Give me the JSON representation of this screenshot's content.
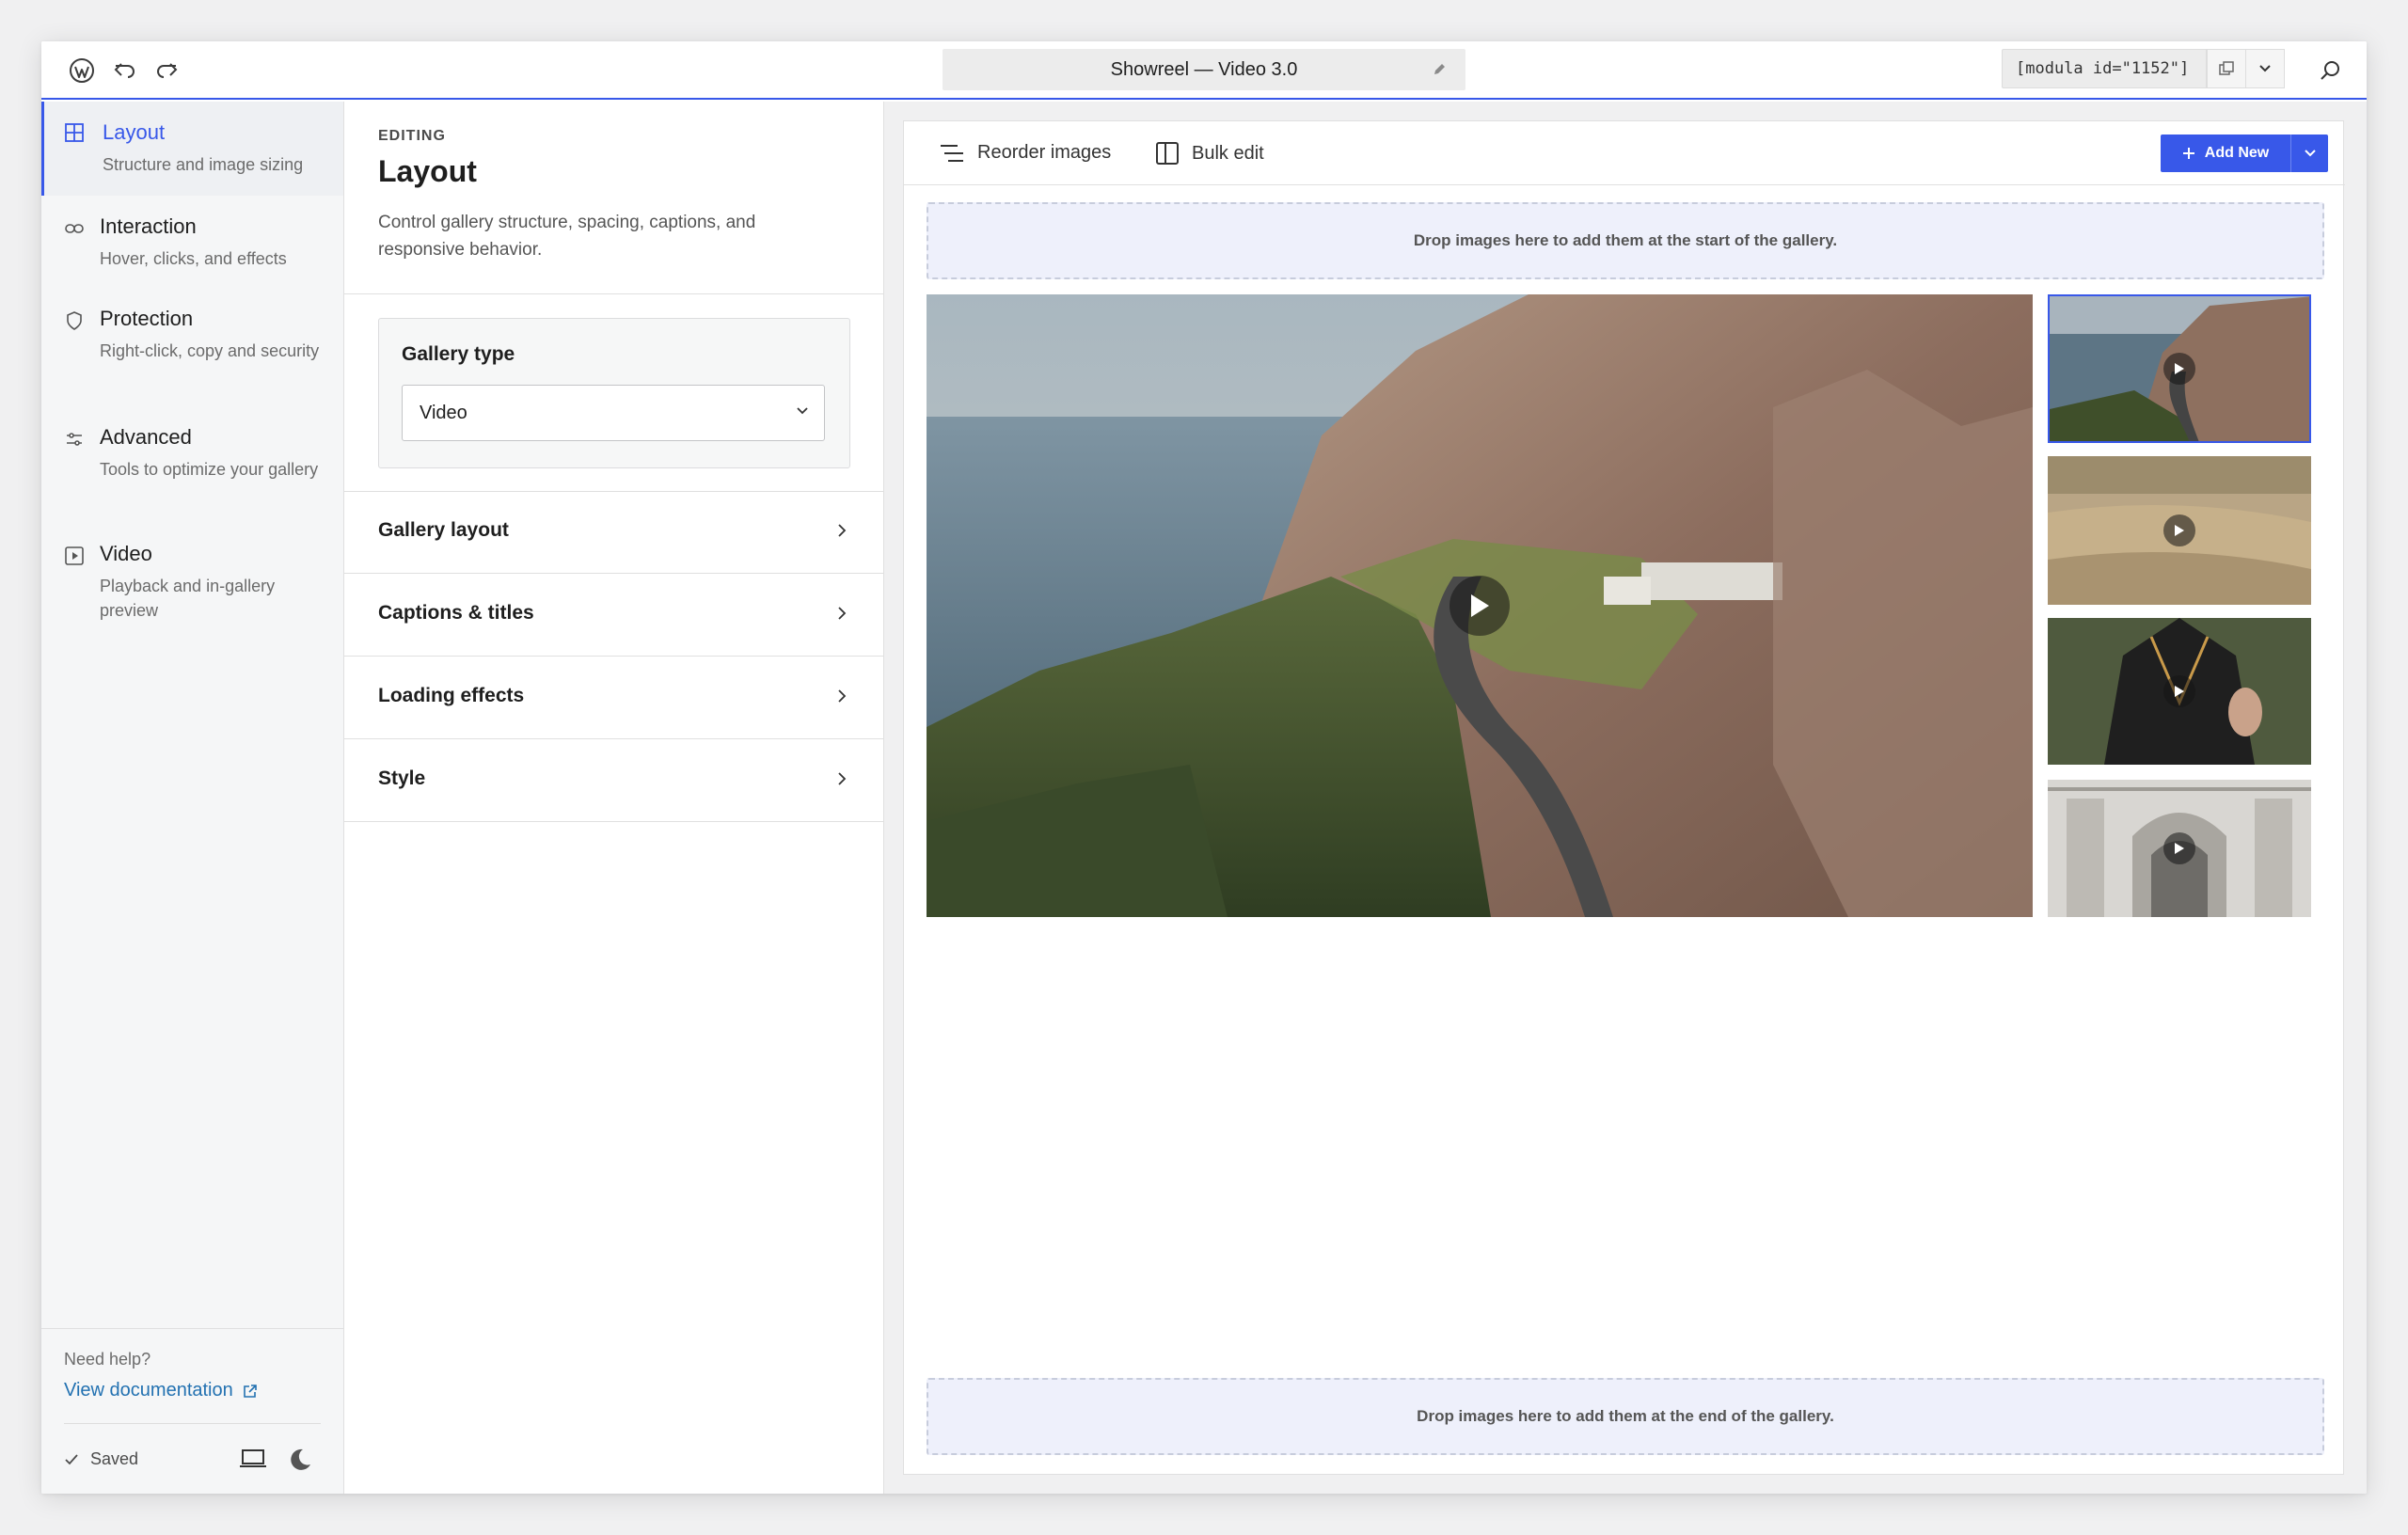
{
  "header": {
    "title": "Showreel — Video 3.0",
    "shortcode": "[modula id=\"1152\"]"
  },
  "sidebar": {
    "items": [
      {
        "label": "Layout",
        "desc": "Structure and image sizing",
        "icon": "grid-icon"
      },
      {
        "label": "Interaction",
        "desc": "Hover, clicks, and effects",
        "icon": "link-icon"
      },
      {
        "label": "Protection",
        "desc": "Right-click, copy and security",
        "icon": "shield-icon"
      },
      {
        "label": "Advanced",
        "desc": "Tools to optimize your gallery",
        "icon": "sliders-icon"
      },
      {
        "label": "Video",
        "desc": "Playback and in-gallery preview",
        "icon": "video-icon"
      }
    ],
    "help_label": "Need help?",
    "doc_link": "View documentation",
    "saved_label": "Saved"
  },
  "settings": {
    "editing_label": "EDITING",
    "title": "Layout",
    "description": "Control gallery structure, spacing, captions, and responsive behavior.",
    "gallery_type_label": "Gallery type",
    "gallery_type_value": "Video",
    "accordions": [
      "Gallery layout",
      "Captions & titles",
      "Loading effects",
      "Style"
    ]
  },
  "main": {
    "reorder_label": "Reorder images",
    "bulk_edit_label": "Bulk edit",
    "add_new_label": "Add New",
    "drop_start": "Drop images here to add them at the start of the gallery.",
    "drop_end": "Drop images here to add them at the end of the gallery."
  },
  "colors": {
    "accent": "#3858e9",
    "link": "#2271b1"
  }
}
